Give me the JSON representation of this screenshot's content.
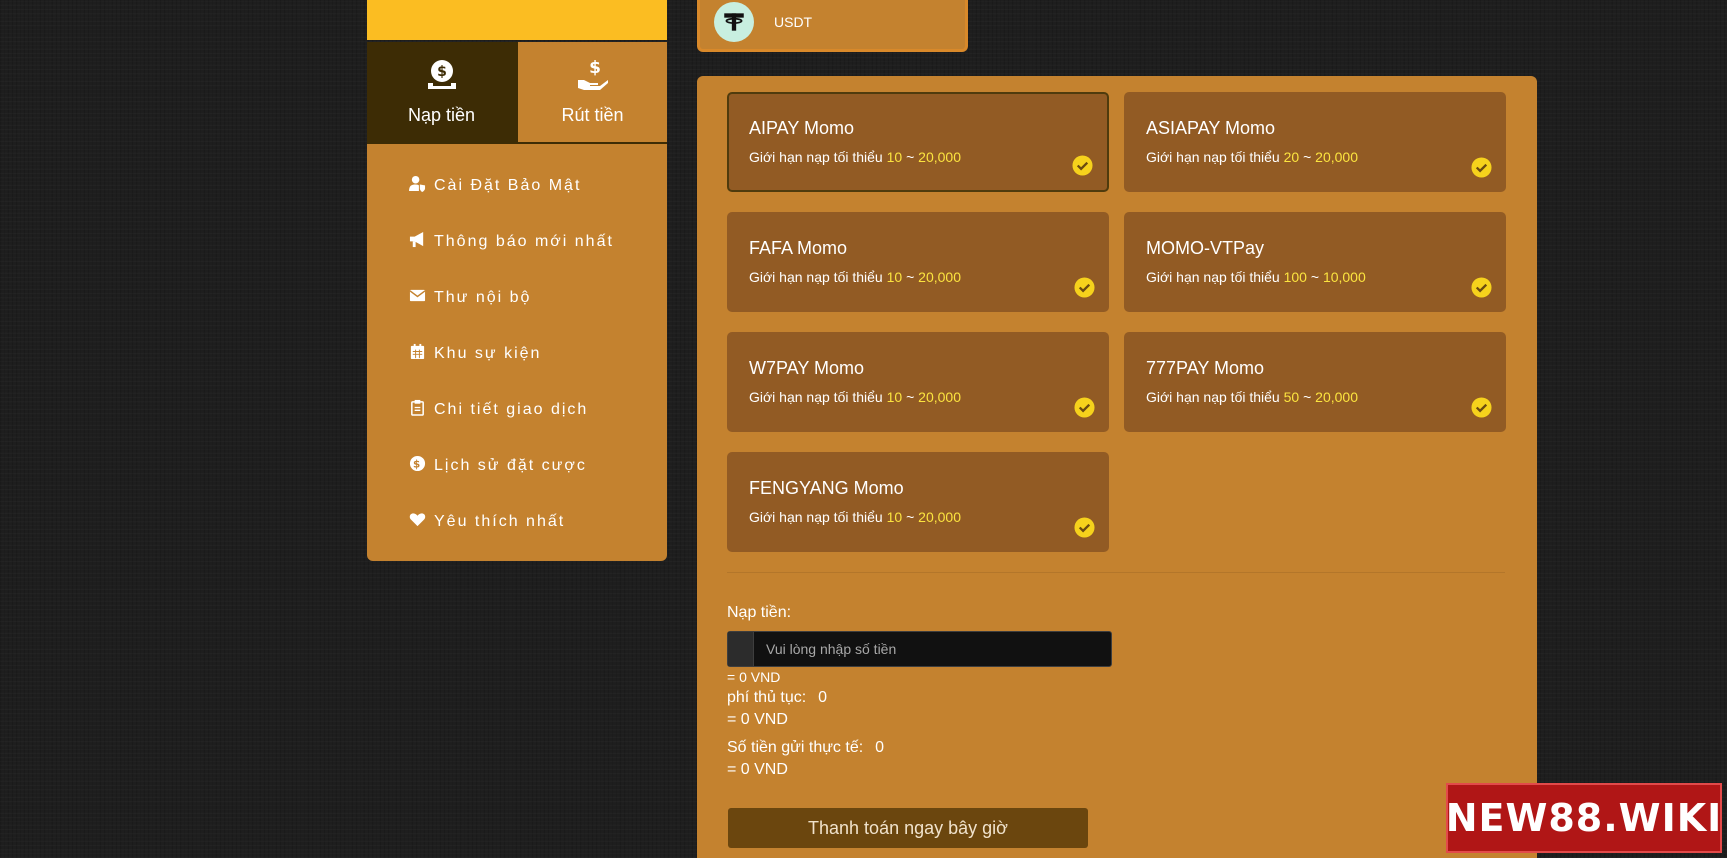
{
  "sidebar": {
    "tabs": [
      {
        "label": "Nạp tiền",
        "icon": "money-bag-icon",
        "active": true
      },
      {
        "label": "Rút tiền",
        "icon": "hand-money-icon",
        "active": false
      }
    ],
    "menu": [
      {
        "label": "Cài Đặt Bảo Mật",
        "icon": "user-shield-icon"
      },
      {
        "label": "Thông báo mới nhất",
        "icon": "megaphone-icon"
      },
      {
        "label": "Thư nội bộ",
        "icon": "envelope-icon"
      },
      {
        "label": "Khu sự kiện",
        "icon": "calendar-icon"
      },
      {
        "label": "Chi tiết giao dịch",
        "icon": "clipboard-icon"
      },
      {
        "label": "Lịch sử đặt cược",
        "icon": "dollar-circle-icon"
      },
      {
        "label": "Yêu thích nhất",
        "icon": "heart-icon"
      }
    ]
  },
  "method": {
    "label": "USDT",
    "icon": "tether-icon"
  },
  "channels": [
    {
      "name": "AIPAY Momo",
      "limit_prefix": "Giới hạn nạp tối thiểu",
      "min": "10",
      "sep": "~",
      "max": "20,000",
      "selected": true
    },
    {
      "name": "ASIAPAY Momo",
      "limit_prefix": "Giới hạn nạp tối thiểu",
      "min": "20",
      "sep": "~",
      "max": "20,000",
      "selected": false
    },
    {
      "name": "FAFA Momo",
      "limit_prefix": "Giới hạn nạp tối thiểu",
      "min": "10",
      "sep": "~",
      "max": "20,000",
      "selected": false
    },
    {
      "name": "MOMO-VTPay",
      "limit_prefix": "Giới hạn nạp tối thiểu",
      "min": "100",
      "sep": "~",
      "max": "10,000",
      "selected": false
    },
    {
      "name": "W7PAY Momo",
      "limit_prefix": "Giới hạn nạp tối thiểu",
      "min": "10",
      "sep": "~",
      "max": "20,000",
      "selected": false
    },
    {
      "name": "777PAY Momo",
      "limit_prefix": "Giới hạn nạp tối thiểu",
      "min": "50",
      "sep": "~",
      "max": "20,000",
      "selected": false
    },
    {
      "name": "FENGYANG Momo",
      "limit_prefix": "Giới hạn nạp tối thiểu",
      "min": "10",
      "sep": "~",
      "max": "20,000",
      "selected": false
    }
  ],
  "form": {
    "amount_label": "Nạp tiền:",
    "amount_placeholder": "Vui lòng nhập số tiền",
    "amount_vnd": "= 0 VND",
    "fee_label": "phí thủ tục:",
    "fee_value": "0",
    "fee_vnd": "= 0 VND",
    "actual_label": "Số tiền gửi thực tế:",
    "actual_value": "0",
    "actual_vnd": "= 0 VND",
    "submit_label": "Thanh toán ngay bây giờ"
  },
  "watermark": {
    "text": "NEW88.WIKI"
  },
  "colors": {
    "background": "#1e1e1e",
    "panel": "#c4822f",
    "card": "#925b24",
    "active_tab": "#3d2c05",
    "accent_yellow": "#fbbd22",
    "limit_text": "#fce43f",
    "button": "#6b460e",
    "watermark": "#b01616"
  }
}
